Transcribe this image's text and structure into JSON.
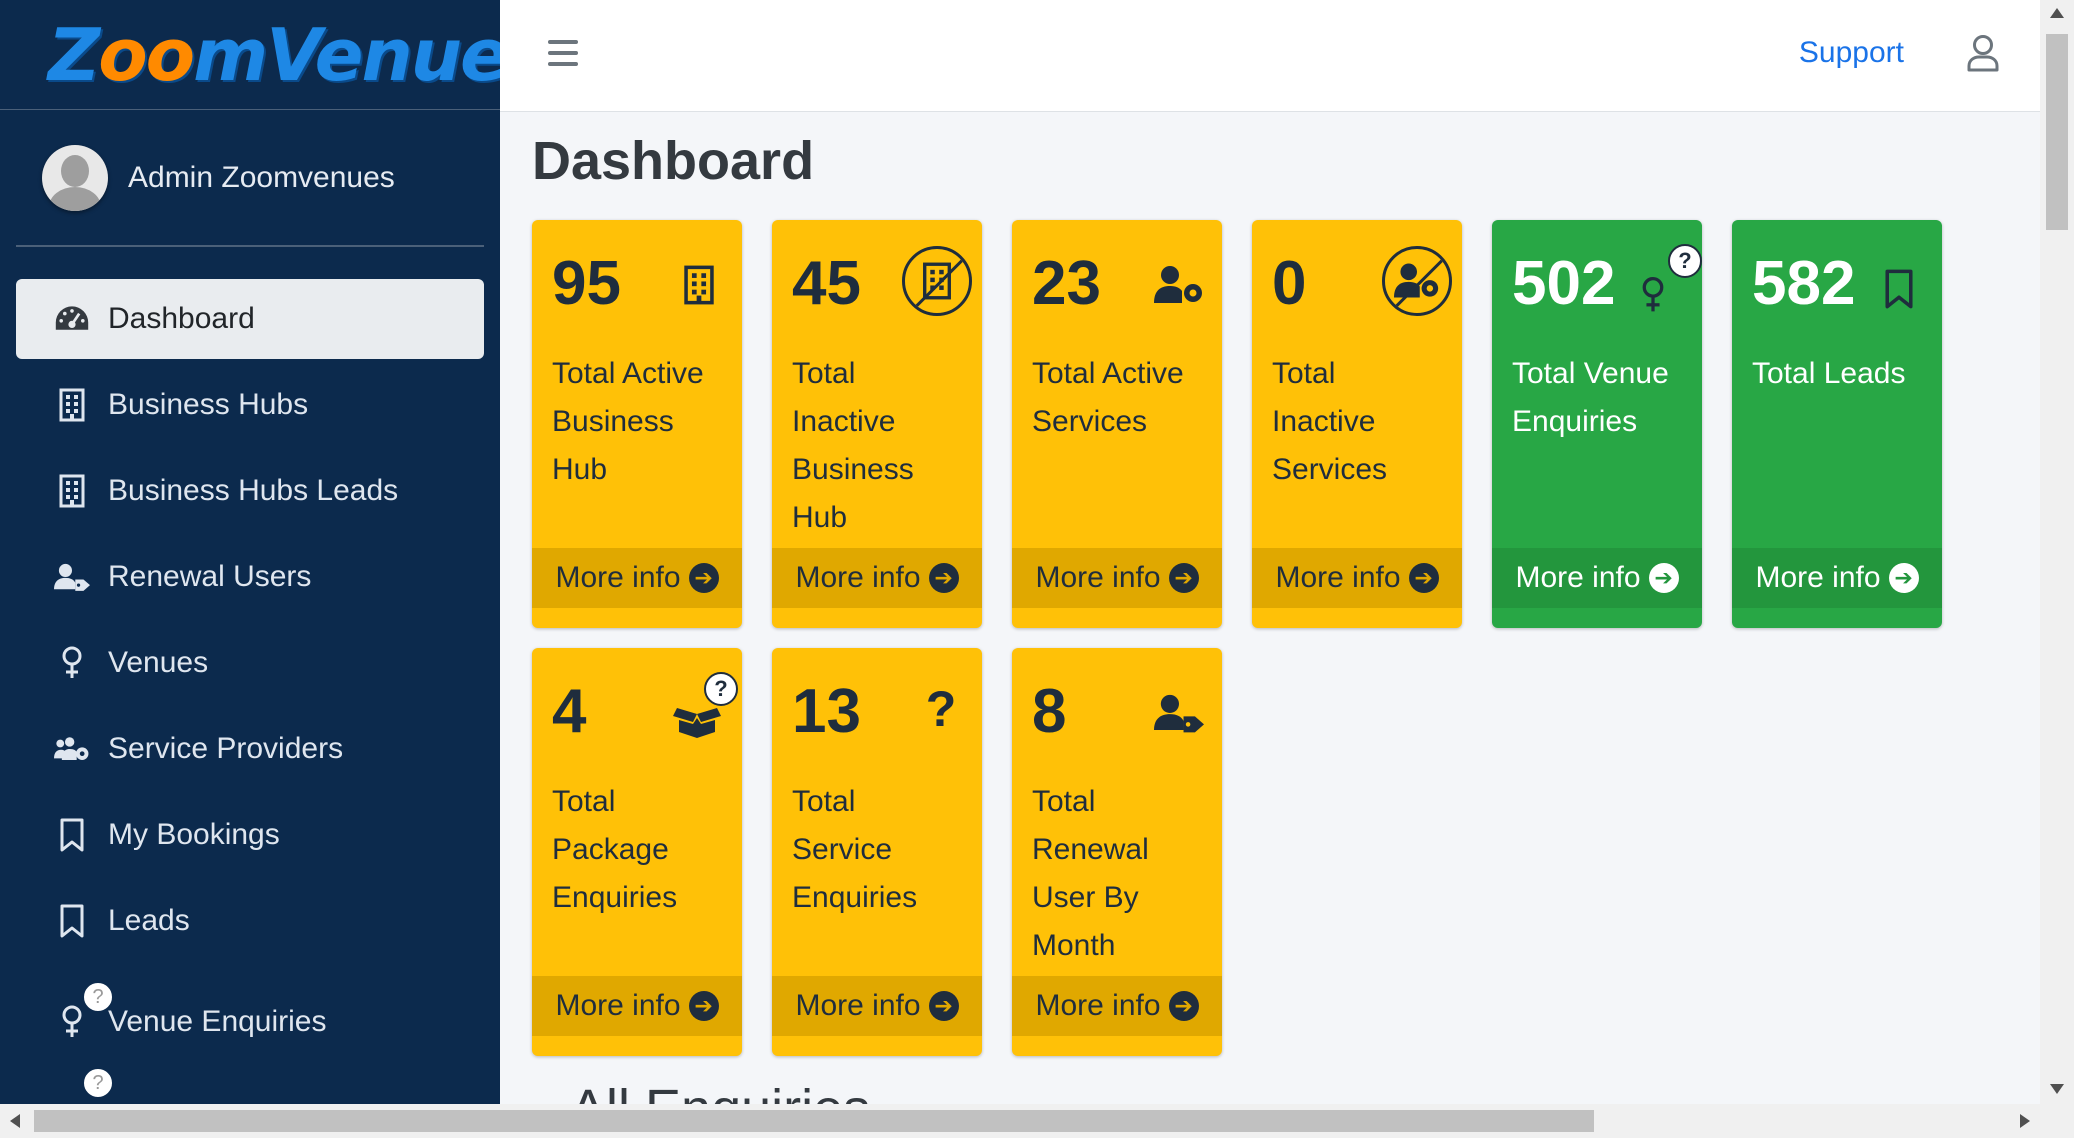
{
  "brand": {
    "logo_text_1": "Z",
    "logo_text_oo": "oo",
    "logo_text_2": "mVenues"
  },
  "user": {
    "name": "Admin Zoomvenues"
  },
  "sidebar": {
    "items": [
      {
        "label": "Dashboard",
        "icon": "tachometer-icon",
        "active": true
      },
      {
        "label": "Business Hubs",
        "icon": "building-icon"
      },
      {
        "label": "Business Hubs Leads",
        "icon": "building-icon"
      },
      {
        "label": "Renewal Users",
        "icon": "user-tag-icon"
      },
      {
        "label": "Venues",
        "icon": "venus-icon"
      },
      {
        "label": "Service Providers",
        "icon": "users-cog-icon"
      },
      {
        "label": "My Bookings",
        "icon": "bookmark-icon"
      },
      {
        "label": "Leads",
        "icon": "bookmark-icon"
      },
      {
        "label": "Venue Enquiries",
        "icon": "venus-question-icon"
      }
    ]
  },
  "topbar": {
    "support_label": "Support"
  },
  "page": {
    "title": "Dashboard",
    "section_title": "All Enquiries"
  },
  "cards": [
    {
      "value": "95",
      "label": "Total Active Business Hub",
      "icon": "building-icon",
      "color": "#ffc107"
    },
    {
      "value": "45",
      "label": "Total Inactive Business Hub",
      "icon": "building-slash-icon",
      "color": "#ffc107"
    },
    {
      "value": "23",
      "label": "Total Active Services",
      "icon": "user-cog-icon",
      "color": "#ffc107"
    },
    {
      "value": "0",
      "label": "Total Inactive Services",
      "icon": "user-cog-slash-icon",
      "color": "#ffc107"
    },
    {
      "value": "502",
      "label": "Total Venue Enquiries",
      "icon": "venus-question-icon",
      "color": "#28a745"
    },
    {
      "value": "582",
      "label": "Total Leads",
      "icon": "bookmark-icon",
      "color": "#28a745"
    },
    {
      "value": "4",
      "label": "Total Package Enquiries",
      "icon": "box-question-icon",
      "color": "#ffc107"
    },
    {
      "value": "13",
      "label": "Total Service Enquiries",
      "icon": "question-icon",
      "color": "#ffc107"
    },
    {
      "value": "8",
      "label": "Total Renewal User By Month",
      "icon": "user-tag-icon",
      "color": "#ffc107"
    }
  ],
  "more_info_label": "More info",
  "question_mark": "?"
}
